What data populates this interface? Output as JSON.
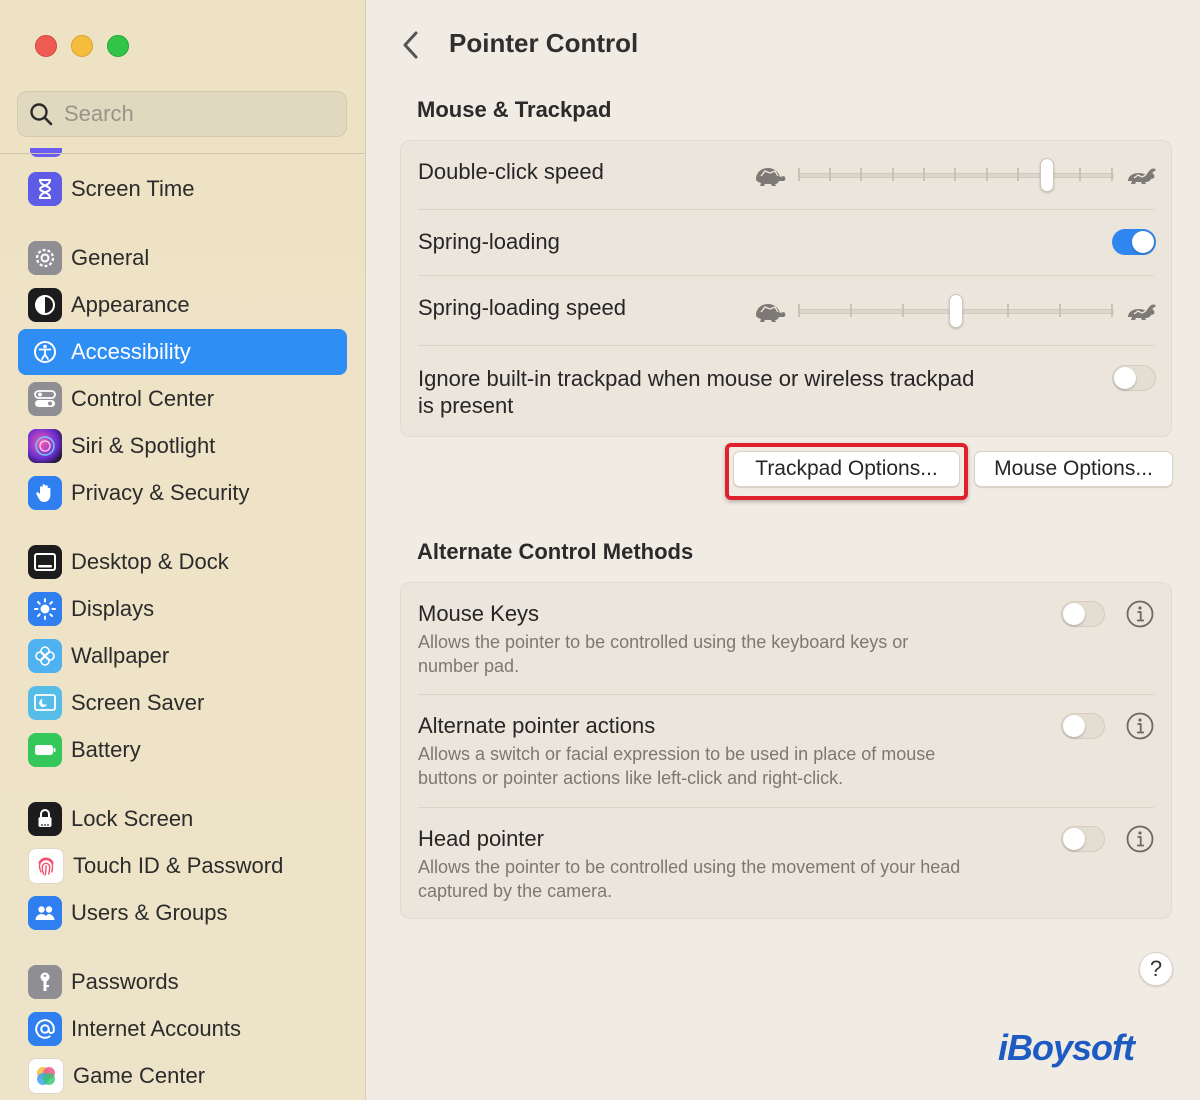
{
  "window": {
    "title": "Pointer Control"
  },
  "sidebar": {
    "search_placeholder": "Search",
    "items": [
      {
        "label": "Screen Time",
        "icon": "hourglass-icon",
        "color": "#5e5ce6",
        "selected": false
      },
      {
        "label": "General",
        "icon": "gear-icon",
        "color": "#8e8e93",
        "selected": false
      },
      {
        "label": "Appearance",
        "icon": "appearance-icon",
        "color": "#1c1c1e",
        "selected": false
      },
      {
        "label": "Accessibility",
        "icon": "accessibility-icon",
        "color": "#2f8ef3",
        "selected": true
      },
      {
        "label": "Control Center",
        "icon": "control-center-icon",
        "color": "#8e8e93",
        "selected": false
      },
      {
        "label": "Siri & Spotlight",
        "icon": "siri-icon",
        "color": "#7a2cc9",
        "selected": false
      },
      {
        "label": "Privacy & Security",
        "icon": "hand-icon",
        "color": "#2f7ff0",
        "selected": false
      },
      {
        "label": "Desktop & Dock",
        "icon": "dock-icon",
        "color": "#1c1c1e",
        "selected": false
      },
      {
        "label": "Displays",
        "icon": "sun-icon",
        "color": "#2f7ff0",
        "selected": false
      },
      {
        "label": "Wallpaper",
        "icon": "flower-icon",
        "color": "#4fb2f0",
        "selected": false
      },
      {
        "label": "Screen Saver",
        "icon": "screen-saver-icon",
        "color": "#55bde8",
        "selected": false
      },
      {
        "label": "Battery",
        "icon": "battery-icon",
        "color": "#34c759",
        "selected": false
      },
      {
        "label": "Lock Screen",
        "icon": "lock-icon",
        "color": "#1c1c1e",
        "selected": false
      },
      {
        "label": "Touch ID & Password",
        "icon": "fingerprint-icon",
        "color": "#ffffff",
        "selected": false
      },
      {
        "label": "Users & Groups",
        "icon": "users-icon",
        "color": "#2f7ff0",
        "selected": false
      },
      {
        "label": "Passwords",
        "icon": "key-icon",
        "color": "#8e8e93",
        "selected": false
      },
      {
        "label": "Internet Accounts",
        "icon": "at-icon",
        "color": "#2f7ff0",
        "selected": false
      },
      {
        "label": "Game Center",
        "icon": "game-center-icon",
        "color": "#ffffff",
        "selected": false
      }
    ]
  },
  "main": {
    "title": "Pointer Control",
    "mouse_trackpad": {
      "title": "Mouse & Trackpad",
      "double_click_speed": {
        "label": "Double-click speed",
        "value": 0.8
      },
      "spring_loading": {
        "label": "Spring-loading",
        "on": true
      },
      "spring_loading_speed": {
        "label": "Spring-loading speed",
        "value": 0.5
      },
      "ignore_trackpad": {
        "label_line1": "Ignore built-in trackpad when mouse or wireless trackpad",
        "label_line2": "is present",
        "on": false
      }
    },
    "buttons": {
      "trackpad_options": "Trackpad Options...",
      "mouse_options": "Mouse Options..."
    },
    "alternate": {
      "title": "Alternate Control Methods",
      "rows": [
        {
          "label": "Mouse Keys",
          "desc1": "Allows the pointer to be controlled using the keyboard keys or",
          "desc2": "number pad.",
          "on": false
        },
        {
          "label": "Alternate pointer actions",
          "desc1": "Allows a switch or facial expression to be used in place of mouse",
          "desc2": "buttons or pointer actions like left-click and right-click.",
          "on": false
        },
        {
          "label": "Head pointer",
          "desc1": "Allows the pointer to be controlled using the movement of your head",
          "desc2": "captured by the camera.",
          "on": false
        }
      ]
    },
    "help_label": "?",
    "watermark": "iBoysoft"
  },
  "colors": {
    "accent": "#2f8ef3",
    "highlight": "#e0202a",
    "toggle_on": "#2f86ee"
  }
}
